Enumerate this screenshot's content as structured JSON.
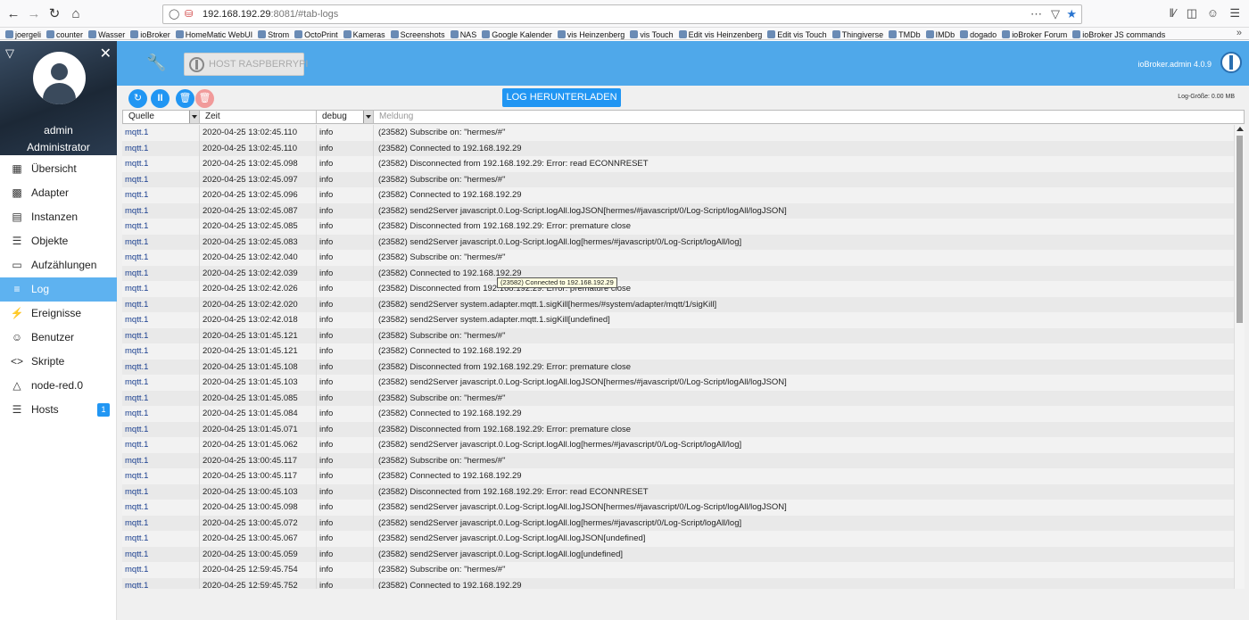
{
  "browser": {
    "url_host": "192.168.192.29",
    "url_rest": ":8081/#tab-logs",
    "bookmarks": [
      "joergeli",
      "counter",
      "Wasser",
      "ioBroker",
      "HomeMatic WebUI",
      "Strom",
      "OctoPrint",
      "Kameras",
      "Screenshots",
      "NAS",
      "Google Kalender",
      "vis Heinzenberg",
      "vis Touch",
      "Edit vis Heinzenberg",
      "Edit vis Touch",
      "Thingiverse",
      "TMDb",
      "IMDb",
      "dogado",
      "ioBroker Forum",
      "ioBroker JS commands"
    ]
  },
  "profile": {
    "name": "admin",
    "role": "Administrator"
  },
  "menu": [
    {
      "label": "Übersicht",
      "icon": "grid-icon"
    },
    {
      "label": "Adapter",
      "icon": "store-icon"
    },
    {
      "label": "Instanzen",
      "icon": "instances-icon"
    },
    {
      "label": "Objekte",
      "icon": "list-icon"
    },
    {
      "label": "Aufzählungen",
      "icon": "enum-icon"
    },
    {
      "label": "Log",
      "icon": "log-icon"
    },
    {
      "label": "Ereignisse",
      "icon": "flash-icon"
    },
    {
      "label": "Benutzer",
      "icon": "user-icon"
    },
    {
      "label": "Skripte",
      "icon": "code-icon"
    },
    {
      "label": "node-red.0",
      "icon": "nodes-icon"
    },
    {
      "label": "Hosts",
      "icon": "hosts-icon",
      "badge": "1"
    }
  ],
  "active_menu": "Log",
  "header": {
    "host_button": "HOST RASPBERRYPI",
    "version": "ioBroker.admin 4.0.9"
  },
  "toolbar": {
    "download_label": "LOG HERUNTERLADEN",
    "log_size": "Log-Größe: 0.00 MB"
  },
  "filters": {
    "source": "Quelle",
    "time": "Zeit",
    "severity": "debug",
    "message_placeholder": "Meldung"
  },
  "tooltip": "(23582) Connected to 192.168.192.29",
  "log_rows": [
    [
      "mqtt.1",
      "2020-04-25 13:02:45.110",
      "info",
      "(23582) Subscribe on: \"hermes/#\""
    ],
    [
      "mqtt.1",
      "2020-04-25 13:02:45.110",
      "info",
      "(23582) Connected to 192.168.192.29"
    ],
    [
      "mqtt.1",
      "2020-04-25 13:02:45.098",
      "info",
      "(23582) Disconnected from 192.168.192.29: Error: read ECONNRESET"
    ],
    [
      "mqtt.1",
      "2020-04-25 13:02:45.097",
      "info",
      "(23582) Subscribe on: \"hermes/#\""
    ],
    [
      "mqtt.1",
      "2020-04-25 13:02:45.096",
      "info",
      "(23582) Connected to 192.168.192.29"
    ],
    [
      "mqtt.1",
      "2020-04-25 13:02:45.087",
      "info",
      "(23582) send2Server javascript.0.Log-Script.logAll.logJSON[hermes/#javascript/0/Log-Script/logAll/logJSON]"
    ],
    [
      "mqtt.1",
      "2020-04-25 13:02:45.085",
      "info",
      "(23582) Disconnected from 192.168.192.29: Error: premature close"
    ],
    [
      "mqtt.1",
      "2020-04-25 13:02:45.083",
      "info",
      "(23582) send2Server javascript.0.Log-Script.logAll.log[hermes/#javascript/0/Log-Script/logAll/log]"
    ],
    [
      "mqtt.1",
      "2020-04-25 13:02:42.040",
      "info",
      "(23582) Subscribe on: \"hermes/#\""
    ],
    [
      "mqtt.1",
      "2020-04-25 13:02:42.039",
      "info",
      "(23582) Connected to 192.168.192.29"
    ],
    [
      "mqtt.1",
      "2020-04-25 13:02:42.026",
      "info",
      "(23582) Disconnected from 192.168.192.29: Error: premature close"
    ],
    [
      "mqtt.1",
      "2020-04-25 13:02:42.020",
      "info",
      "(23582) send2Server system.adapter.mqtt.1.sigKill[hermes/#system/adapter/mqtt/1/sigKill]"
    ],
    [
      "mqtt.1",
      "2020-04-25 13:02:42.018",
      "info",
      "(23582) send2Server system.adapter.mqtt.1.sigKill[undefined]"
    ],
    [
      "mqtt.1",
      "2020-04-25 13:01:45.121",
      "info",
      "(23582) Subscribe on: \"hermes/#\""
    ],
    [
      "mqtt.1",
      "2020-04-25 13:01:45.121",
      "info",
      "(23582) Connected to 192.168.192.29"
    ],
    [
      "mqtt.1",
      "2020-04-25 13:01:45.108",
      "info",
      "(23582) Disconnected from 192.168.192.29: Error: premature close"
    ],
    [
      "mqtt.1",
      "2020-04-25 13:01:45.103",
      "info",
      "(23582) send2Server javascript.0.Log-Script.logAll.logJSON[hermes/#javascript/0/Log-Script/logAll/logJSON]"
    ],
    [
      "mqtt.1",
      "2020-04-25 13:01:45.085",
      "info",
      "(23582) Subscribe on: \"hermes/#\""
    ],
    [
      "mqtt.1",
      "2020-04-25 13:01:45.084",
      "info",
      "(23582) Connected to 192.168.192.29"
    ],
    [
      "mqtt.1",
      "2020-04-25 13:01:45.071",
      "info",
      "(23582) Disconnected from 192.168.192.29: Error: premature close"
    ],
    [
      "mqtt.1",
      "2020-04-25 13:01:45.062",
      "info",
      "(23582) send2Server javascript.0.Log-Script.logAll.log[hermes/#javascript/0/Log-Script/logAll/log]"
    ],
    [
      "mqtt.1",
      "2020-04-25 13:00:45.117",
      "info",
      "(23582) Subscribe on: \"hermes/#\""
    ],
    [
      "mqtt.1",
      "2020-04-25 13:00:45.117",
      "info",
      "(23582) Connected to 192.168.192.29"
    ],
    [
      "mqtt.1",
      "2020-04-25 13:00:45.103",
      "info",
      "(23582) Disconnected from 192.168.192.29: Error: read ECONNRESET"
    ],
    [
      "mqtt.1",
      "2020-04-25 13:00:45.098",
      "info",
      "(23582) send2Server javascript.0.Log-Script.logAll.logJSON[hermes/#javascript/0/Log-Script/logAll/logJSON]"
    ],
    [
      "mqtt.1",
      "2020-04-25 13:00:45.072",
      "info",
      "(23582) send2Server javascript.0.Log-Script.logAll.log[hermes/#javascript/0/Log-Script/logAll/log]"
    ],
    [
      "mqtt.1",
      "2020-04-25 13:00:45.067",
      "info",
      "(23582) send2Server javascript.0.Log-Script.logAll.logJSON[undefined]"
    ],
    [
      "mqtt.1",
      "2020-04-25 13:00:45.059",
      "info",
      "(23582) send2Server javascript.0.Log-Script.logAll.log[undefined]"
    ],
    [
      "mqtt.1",
      "2020-04-25 12:59:45.754",
      "info",
      "(23582) Subscribe on: \"hermes/#\""
    ],
    [
      "mqtt.1",
      "2020-04-25 12:59:45.752",
      "info",
      "(23582) Connected to 192.168.192.29"
    ]
  ]
}
